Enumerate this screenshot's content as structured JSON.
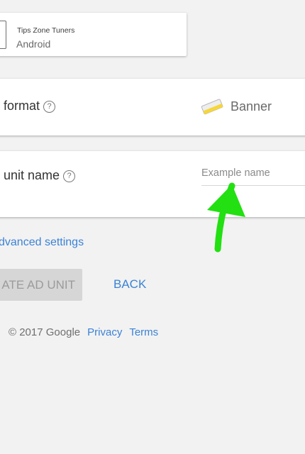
{
  "app": {
    "name": "Tips Zone Tuners",
    "platform": "Android"
  },
  "ad_format": {
    "label": "d format",
    "help_glyph": "?",
    "selected_value": "Banner",
    "selected_icon": "banner-icon"
  },
  "ad_unit_name": {
    "label": "d unit name",
    "help_glyph": "?",
    "value": "",
    "placeholder": "Example name"
  },
  "annotation": {
    "arrow_color": "#22e011"
  },
  "advanced_settings_link": "dvanced settings",
  "actions": {
    "create_label": "ATE AD UNIT",
    "back_label": "BACK"
  },
  "footer": {
    "copyright": "© 2017 Google",
    "privacy_label": "Privacy",
    "terms_label": "Terms"
  },
  "colors": {
    "background": "#f2f2f2",
    "link": "#3b82d6",
    "disabled_button": "#d6d6d6"
  }
}
